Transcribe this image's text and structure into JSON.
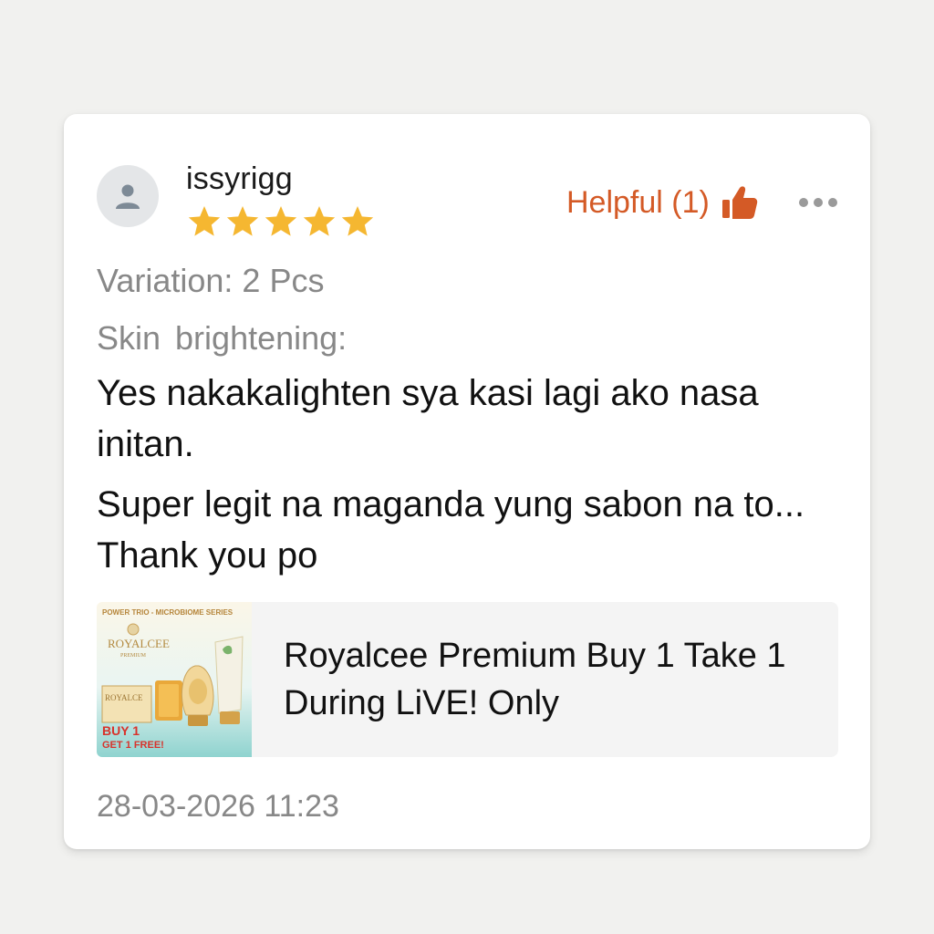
{
  "review": {
    "username": "issyrigg",
    "rating": 5,
    "rating_max": 5,
    "helpful_label": "Helpful (1)",
    "variation": "Variation: 2 Pcs",
    "attribute_label": "Skin brightening:",
    "paragraphs": [
      "Yes  nakakalighten sya kasi lagi ako nasa initan.",
      "Super legit na maganda yung sabon na to... Thank you po"
    ],
    "timestamp": "28-03-2026 11:23"
  },
  "product": {
    "name": "Royalcee Premium Buy 1 Take 1 During LiVE! Only",
    "image_text": {
      "banner": "POWER TRIO - MICROBIOME SERIES",
      "brand": "ROYALCEE",
      "brand_sub": "PREMIUM",
      "box_label": "ROYALCE",
      "promo_line1": "BUY 1",
      "promo_line2": "GET 1 FREE!"
    }
  },
  "icons": {
    "avatar": "user-icon",
    "star": "star-icon",
    "helpful": "thumbs-up-icon",
    "more": "more-horizontal-icon"
  },
  "colors": {
    "accent": "#d45a26",
    "star": "#f5b731",
    "muted_text": "#888888",
    "body_text": "#111111",
    "card_bg": "#ffffff",
    "page_bg": "#f1f1ef"
  }
}
